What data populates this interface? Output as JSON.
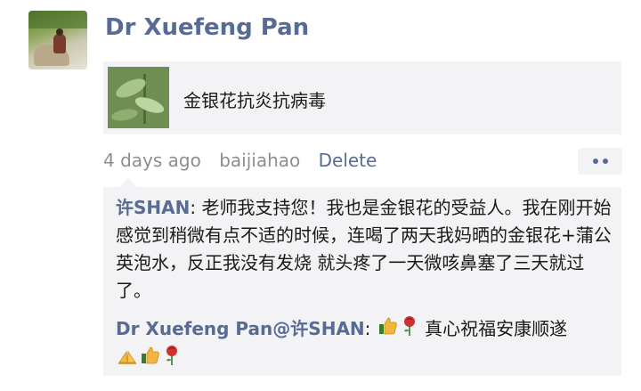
{
  "post": {
    "author": "Dr Xuefeng Pan",
    "link": {
      "title": "金银花抗炎抗病毒"
    },
    "meta": {
      "time": "4 days ago",
      "source": "baijiahao",
      "delete_label": "Delete"
    }
  },
  "comments": [
    {
      "author": "许SHAN",
      "separator": ": ",
      "text": "老师我支持您！我也是金银花的受益人。我在刚开始感觉到稍微有点不适的时候，连喝了两天我妈晒的金银花+蒲公英泡水，反正我没有发烧 就头疼了一天微咳鼻塞了三天就过了。"
    },
    {
      "author": "Dr Xuefeng Pan",
      "at": "@",
      "reply_to": "许SHAN",
      "separator": ": ",
      "text_before": "",
      "text": " 真心祝福安康顺遂",
      "emojis_start": [
        "thumbs-up-icon",
        "rose-icon"
      ],
      "emojis_end": [
        "folded-hands-icon",
        "thumbs-up-icon",
        "rose-icon"
      ]
    }
  ],
  "colors": {
    "link_blue": "#576b95",
    "panel_bg": "#f3f3f5",
    "meta_gray": "#8e8e8e"
  }
}
